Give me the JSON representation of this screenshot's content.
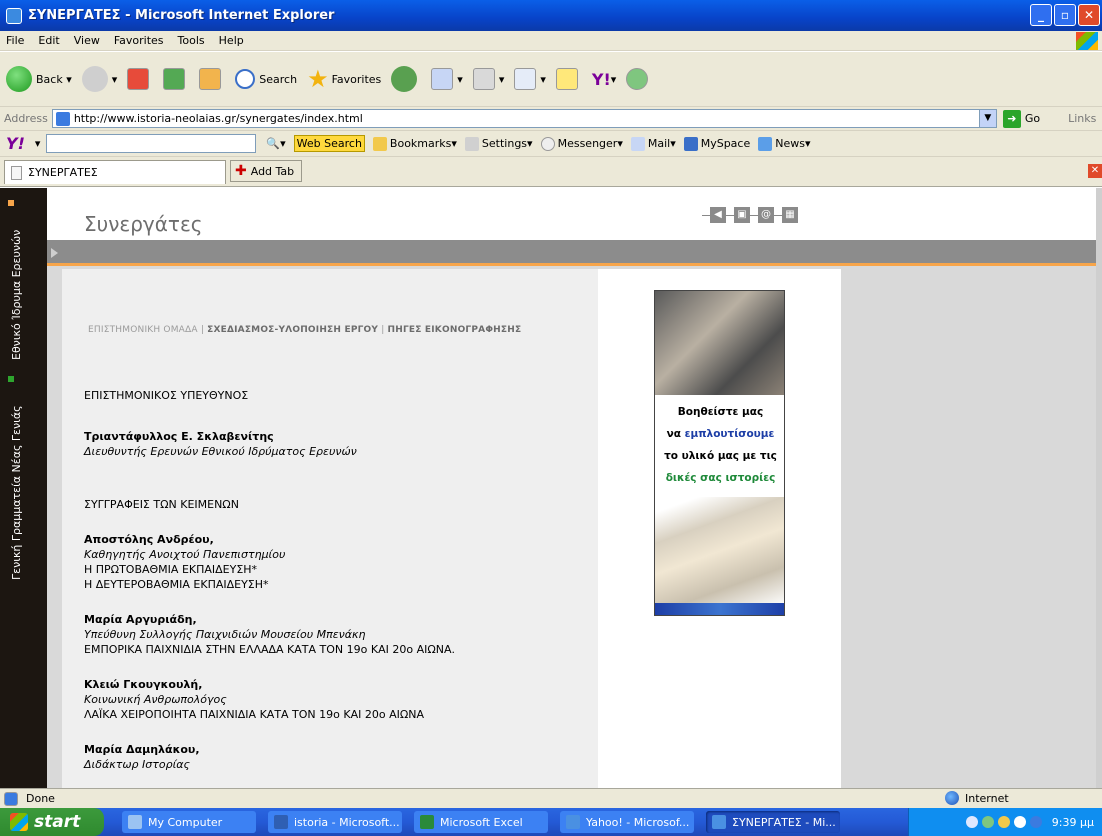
{
  "window": {
    "title": "ΣΥΝΕΡΓΑΤΕΣ - Microsoft Internet Explorer"
  },
  "menu": [
    "File",
    "Edit",
    "View",
    "Favorites",
    "Tools",
    "Help"
  ],
  "toolbar": {
    "back": "Back",
    "search": "Search",
    "favorites": "Favorites"
  },
  "address": {
    "label": "Address",
    "url": "http://www.istoria-neolaias.gr/synergates/index.html",
    "go": "Go",
    "links": "Links"
  },
  "yahoo": {
    "logo": "Y!",
    "web_search": "Web Search",
    "bookmarks": "Bookmarks",
    "settings": "Settings",
    "messenger": "Messenger",
    "mail": "Mail",
    "myspace": "MySpace",
    "news": "News"
  },
  "tabs": {
    "current": "ΣΥΝΕΡΓΑΤΕΣ",
    "add": "Add Tab"
  },
  "site": {
    "side_text_top": "Εθνικό Ίδρυμα Ερευνών",
    "side_text_bottom": "Γενική Γραμματεία Νέας Γενιάς",
    "title": "Συνεργάτες",
    "nav": {
      "a": "ΕΠΙΣΤΗΜΟΝΙΚΗ ΟΜΑΔΑ",
      "sep": "|",
      "b": "ΣΧΕΔΙΑΣΜΟΣ-ΥΛΟΠΟΙΗΣΗ ΕΡΓΟΥ",
      "c": "ΠΗΓΕΣ ΕΙΚΟΝΟΓΡΑΦΗΣΗΣ"
    },
    "content": {
      "h1": "ΕΠΙΣΤΗΜΟΝΙΚΟΣ ΥΠΕΥΘΥΝΟΣ",
      "p1_name": "Τριαντάφυλλος Ε. Σκλαβενίτης",
      "p1_role": "Διευθυντής Ερευνών Εθνικού Ιδρύματος Ερευνών",
      "h2": "ΣΥΓΓΡΑΦΕΙΣ ΤΩΝ ΚΕΙΜΕΝΩΝ",
      "p2_name": "Αποστόλης Ανδρέου",
      "p2_role": "Καθηγητής Ανοιχτού Πανεπιστημίου",
      "p2_l1": "Η ΠΡΩΤΟΒΑΘΜΙΑ ΕΚΠΑΙΔΕΥΣΗ*",
      "p2_l2": "Η ΔΕΥΤΕΡΟΒΑΘΜΙΑ ΕΚΠΑΙΔΕΥΣΗ*",
      "p3_name": "Μαρία Αργυριάδη",
      "p3_role": "Υπεύθυνη Συλλογής Παιχνιδιών Μουσείου Μπενάκη",
      "p3_l1": "ΕΜΠΟΡΙΚΑ ΠΑΙΧΝΙΔΙΑ ΣΤΗΝ ΕΛΛΑΔΑ ΚΑΤΑ ΤΟΝ 19ο ΚΑΙ 20ο ΑΙΩΝΑ.",
      "p4_name": "Κλειώ Γκουγκουλή",
      "p4_role": "Κοινωνική Ανθρωπολόγος",
      "p4_l1": "ΛΑΪΚΑ ΧΕΙΡΟΠΟΙΗΤΑ ΠΑΙΧΝΙΔΙΑ ΚΑΤΑ ΤΟΝ 19ο ΚΑΙ 20ο ΑΙΩΝΑ",
      "p5_name": "Μαρία Δαμηλάκου",
      "p5_role": "Διδάκτωρ Ιστορίας",
      "comma": ","
    },
    "banner": {
      "l1": "Βοηθείστε μας",
      "l2a": "να ",
      "l2b": "εμπλουτίσουμε",
      "l3": "το υλικό μας με τις",
      "l4": "δικές σας ιστορίες"
    }
  },
  "status": {
    "text": "Done",
    "zone": "Internet"
  },
  "taskbar": {
    "start": "start",
    "items": [
      "My Computer",
      "istoria - Microsoft...",
      "Microsoft Excel",
      "Yahoo! - Microsof...",
      "ΣΥΝΕΡΓΑΤΕΣ - Mi..."
    ],
    "clock": "9:39 μμ"
  },
  "colors": {
    "accent_orange": "#f7a54a",
    "banner_blue": "#1d3ea6",
    "banner_green": "#1f8a3a"
  }
}
